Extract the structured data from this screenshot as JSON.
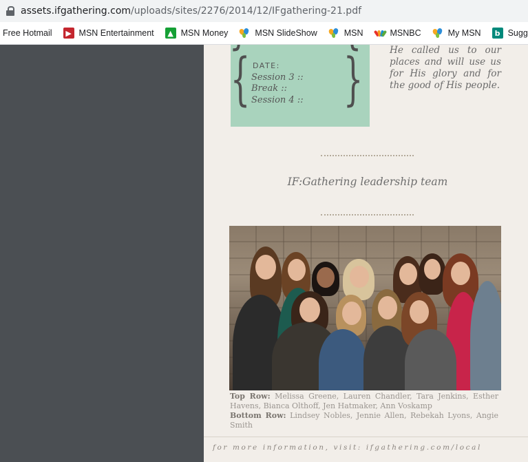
{
  "browser": {
    "url_host": "assets.ifgathering.com",
    "url_path": "/uploads/sites/2276/2014/12/IFgathering-21.pdf"
  },
  "bookmarks": [
    {
      "label": "Free Hotmail",
      "icon": "none"
    },
    {
      "label": "MSN Entertainment",
      "icon": "msn-entertainment-icon"
    },
    {
      "label": "MSN Money",
      "icon": "msn-money-icon"
    },
    {
      "label": "MSN SlideShow",
      "icon": "msn-butterfly-icon"
    },
    {
      "label": "MSN",
      "icon": "msn-butterfly-icon"
    },
    {
      "label": "MSNBC",
      "icon": "msnbc-peacock-icon"
    },
    {
      "label": "My MSN",
      "icon": "msn-butterfly-icon"
    },
    {
      "label": "Suggested",
      "icon": "bing-icon"
    }
  ],
  "document": {
    "schedule": {
      "date_label": "DATE:",
      "sessions": [
        "Session 3 ::",
        "Break ::",
        "Session 4 ::"
      ]
    },
    "quote_lines": [
      "He called us to our",
      "places and will use us",
      "for His glory and for",
      "the good of His people."
    ],
    "section_title": "IF:Gathering leadership team",
    "caption": {
      "top_label": "Top Row:",
      "top_names": "Melissa Greene, Lauren Chandler, Tara Jenkins, Esther Havens, Bianca Olthoff, Jen Hatmaker, Ann Voskamp",
      "bottom_label": "Bottom Row:",
      "bottom_names": "Lindsey Nobles, Jennie Allen, Rebekah Lyons, Angie Smith"
    },
    "footer": "for more information, visit: ifgathering.com/local"
  },
  "colors": {
    "sidebar": "#4b4f53",
    "page": "#f2eee9",
    "mint": "#a9d3bd"
  }
}
